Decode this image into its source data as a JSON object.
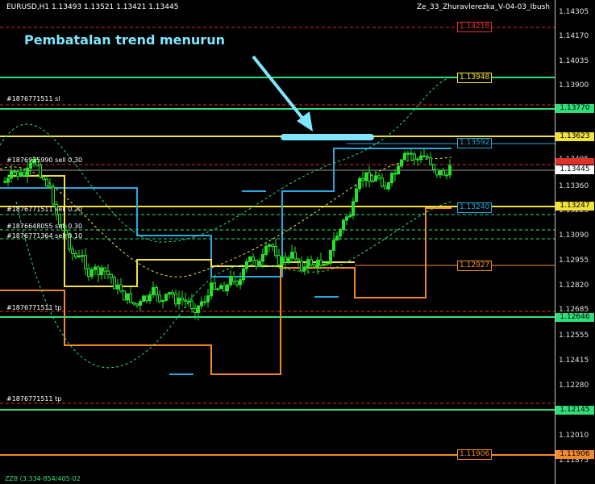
{
  "header": {
    "symbol_info": "EURUSD,H1  1.13493 1.13521 1.13421 1.13445",
    "expert_name": "Ze_33_Zhuravlerezka_V-04-03_Ibush"
  },
  "annotation": {
    "title": "Pembatalan trend menurun"
  },
  "axis": {
    "ticks": [
      "1.14305",
      "1.14170",
      "1.14035",
      "1.13900",
      "1.13495",
      "1.13360",
      "1.13225",
      "1.13090",
      "1.12955",
      "1.12820",
      "1.12685",
      "1.12555",
      "1.12415",
      "1.12280",
      "1.12145",
      "1.12010",
      "1.11875"
    ],
    "current_price": "1.13445",
    "boxes": [
      {
        "label": "1.13770",
        "color": "#2fe07a"
      },
      {
        "label": "1.13623",
        "color": "#f2e23a"
      },
      {
        "label": "1.13445",
        "color": "#ffffff"
      },
      {
        "label": "1.13247",
        "color": "#f2e23a"
      },
      {
        "label": "1.12646",
        "color": "#2fe07a"
      },
      {
        "label": "1.12145",
        "color": "#2fe07a"
      },
      {
        "label": "1.11906",
        "color": "#f28a2a"
      }
    ]
  },
  "level_tags": [
    {
      "label": "1.14218",
      "color": "#e0302a"
    },
    {
      "label": "1.13948",
      "color": "#f2e23a"
    },
    {
      "label": "1.13592",
      "color": "#2aa8e0"
    },
    {
      "label": "1.13240",
      "color": "#2aa8e0"
    },
    {
      "label": "1.12927",
      "color": "#f28a2a"
    },
    {
      "label": "1.11906",
      "color": "#f28a2a"
    }
  ],
  "orders": [
    "#1876771511 sl",
    "#1876935990 sell 0.30",
    "#1876771511 sell 0.20",
    "#1876648055 sell 0.30",
    "#1876771364 sell 0.10",
    "#1876771511 tp",
    "#1876771511 tp"
  ],
  "footer": {
    "status": "ZZ8 (3,334-854/405-02"
  },
  "colors": {
    "bull": "#27e02a",
    "bear": "#27e02a",
    "level_green": "#2fe07a",
    "level_yellow": "#f2e23a",
    "level_red": "#e0302a",
    "level_orange": "#f28a2a",
    "level_blue": "#2aa8e0",
    "arrow": "#7fe6ff"
  }
}
